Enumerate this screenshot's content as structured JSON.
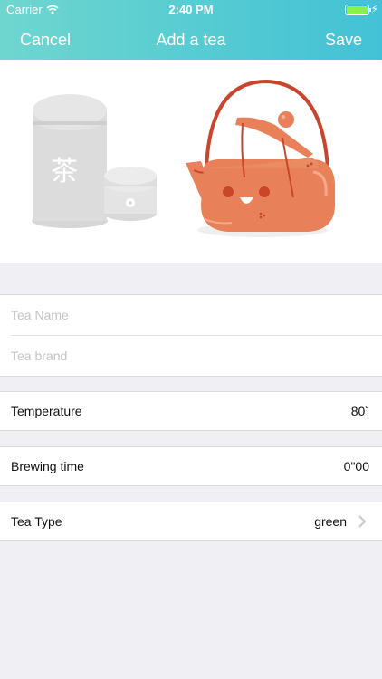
{
  "status": {
    "carrier": "Carrier",
    "time": "2:40 PM"
  },
  "nav": {
    "cancel": "Cancel",
    "title": "Add a tea",
    "save": "Save"
  },
  "hero": {
    "tin_glyph": "茶"
  },
  "form": {
    "tea_name_placeholder": "Tea Name",
    "tea_brand_placeholder": "Tea brand"
  },
  "rows": {
    "temperature": {
      "label": "Temperature",
      "value": "80˚"
    },
    "brewing_time": {
      "label": "Brewing time",
      "value": "0\"00"
    },
    "tea_type": {
      "label": "Tea Type",
      "value": "green"
    }
  },
  "colors": {
    "accent_start": "#6fd6cf",
    "accent_end": "#43c1d6",
    "teapot": "#e8805a",
    "teapot_handle": "#c9452c"
  }
}
